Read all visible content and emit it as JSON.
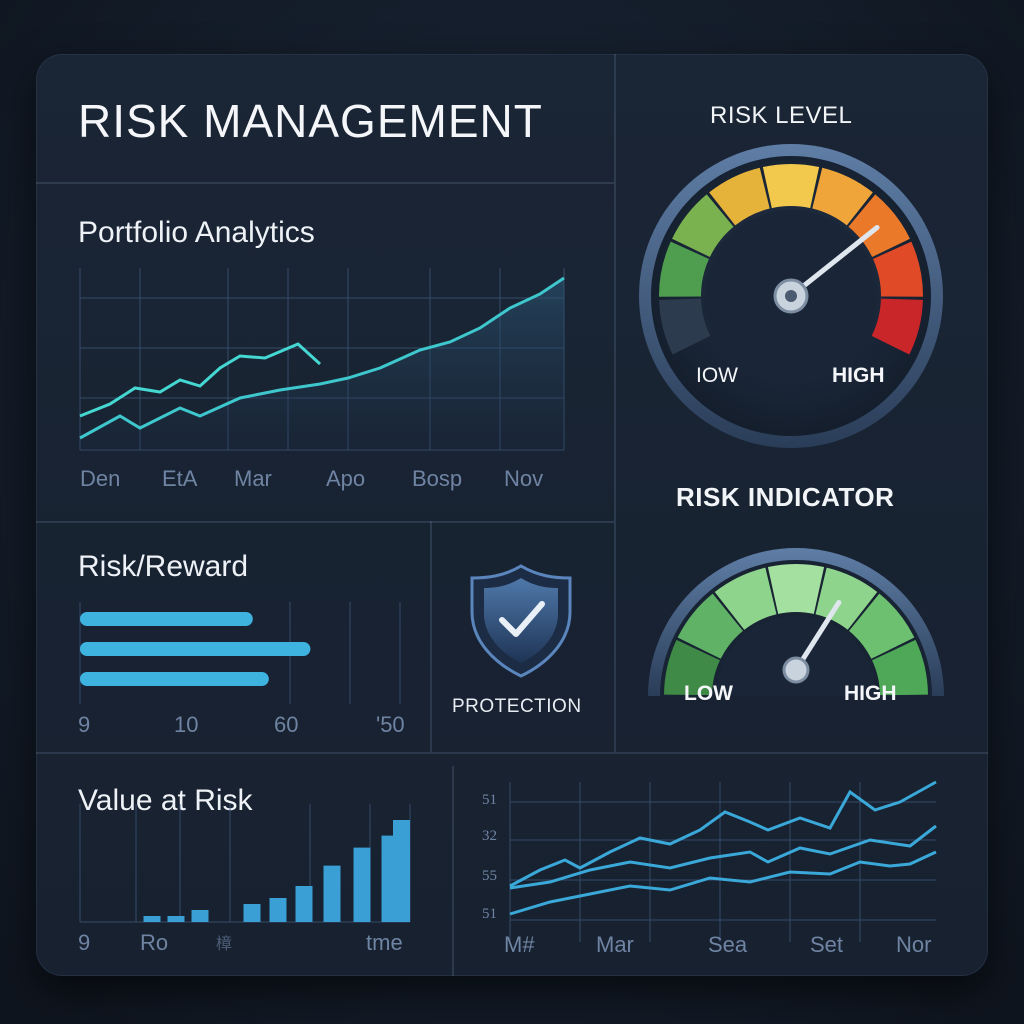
{
  "header": {
    "title": "RISK MANAGEMENT"
  },
  "portfolio": {
    "title": "Portfolio Analytics",
    "x_labels": [
      "Den",
      "EtA",
      "Mar",
      "Apo",
      "Bosp",
      "Nov"
    ]
  },
  "risk_reward": {
    "title": "Risk/Reward",
    "x_labels": [
      "9",
      "10",
      "60",
      "'50"
    ],
    "bars": [
      0.54,
      0.72,
      0.59
    ]
  },
  "protection": {
    "label": "PROTECTION",
    "icon": "shield-check-icon"
  },
  "value_at_risk": {
    "title": "Value at Risk",
    "x_labels": [
      "9",
      "Ro",
      "樟",
      "tme"
    ],
    "bars": [
      0.05,
      0.05,
      0.1,
      0.15,
      0.2,
      0.3,
      0.47,
      0.62,
      0.72,
      0.85
    ]
  },
  "trends": {
    "y_labels": [
      "51",
      "32",
      "55",
      "51"
    ],
    "x_labels": [
      "M#",
      "Mar",
      "Sea",
      "Set",
      "Nor"
    ]
  },
  "risk_level": {
    "title": "RISK LEVEL",
    "low_label": "IOW",
    "high_label": "HIGH",
    "value": 0.72
  },
  "risk_indicator": {
    "title": "RISK INDICATOR",
    "low_label": "LOW",
    "high_label": "HIGH",
    "value": 0.68
  },
  "colors": {
    "accent_line": "#3fd3d0",
    "bar_blue": "#3fb3e0",
    "gauge_red": "#d7332a",
    "gauge_green": "#4fb060"
  }
}
